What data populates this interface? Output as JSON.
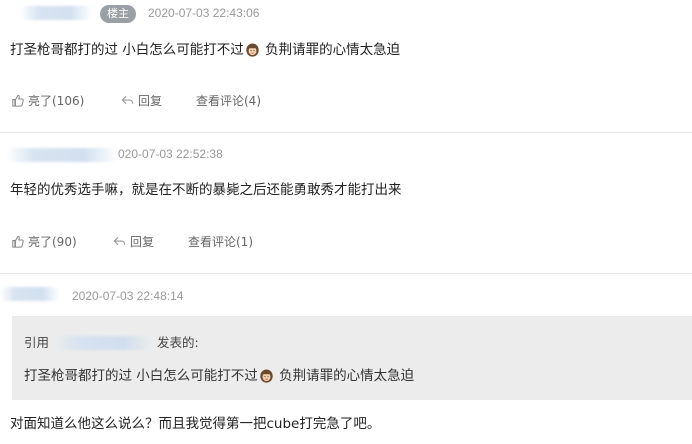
{
  "posts": [
    {
      "badge": "楼主",
      "time": "2020-07-03 22:43:06",
      "text_before": "打圣枪哥都打的过 小白怎么可能打不过",
      "text_after": " 负荆请罪的心情太急迫",
      "like_label": "亮了(106)",
      "reply_label": "回复",
      "comments_label": "查看评论(4)"
    },
    {
      "time": "020-07-03 22:52:38",
      "text": "年轻的优秀选手嘛，就是在不断的暴毙之后还能勇敢秀才能打出来",
      "like_label": "亮了(90)",
      "reply_label": "回复",
      "comments_label": "查看评论(1)"
    },
    {
      "time": "2020-07-03 22:48:14",
      "quote_prefix": "引用",
      "quote_suffix": "发表的:",
      "quote_text_before": "打圣枪哥都打的过 小白怎么可能打不过",
      "quote_text_after": " 负荆请罪的心情太急迫",
      "text": "对面知道么他这么说么？而且我觉得第一把cube打完急了吧。"
    }
  ],
  "icons": {
    "like": "thumbs-up-icon",
    "reply": "reply-arrow-icon",
    "emoji": "woman-face-emoji-icon"
  },
  "colors": {
    "badge_bg": "#9aa0a6",
    "quote_bg": "#ececec",
    "meta_text": "#999999"
  }
}
